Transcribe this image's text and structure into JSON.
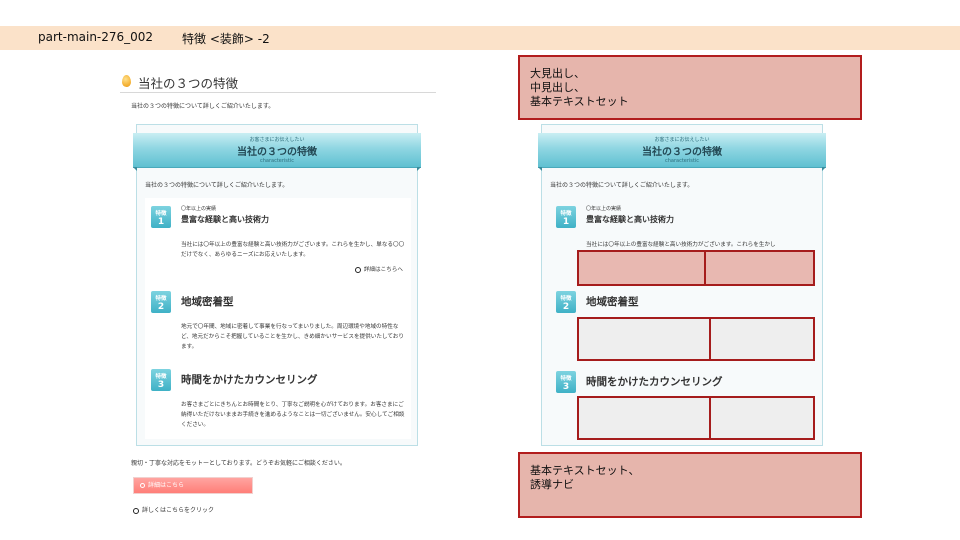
{
  "header": {
    "part_id": "part-main-276_002",
    "title": "特徴 <装飾> -2"
  },
  "section": {
    "heading": "当社の３つの特徴",
    "lead": "当社の３つの特徴について詳しくご紹介いたします。"
  },
  "panel": {
    "ribbon_sub": "お客さまにお伝えしたい",
    "ribbon_title": "当社の３つの特徴",
    "ribbon_en": "characteristic",
    "lead": "当社の３つの特徴について詳しくご紹介いたします。",
    "badge_word": "特徴",
    "features": [
      {
        "num": "1",
        "pre": "〇年以上の実績",
        "title": "豊富な経験と高い技術力",
        "body": "当社には〇年以上の豊富な経験と高い技術力がございます。これらを生かし、単なる〇〇だけでなく、あらゆるニーズにお応えいたします。",
        "link": "詳細はこちらへ"
      },
      {
        "num": "2",
        "title": "地域密着型",
        "body": "地元で〇年間、地域に密着して事業を行なってまいりました。周辺環境や地域の特性など、地元だからこそ把握していることを生かし、きめ細かいサービスを提供いたしております。"
      },
      {
        "num": "3",
        "title": "時間をかけたカウンセリング",
        "body": "お客さまごとにきちんとお時間をとり、丁寧なご説明を心がけております。お客さまにご納得いただけないままお手続きを進めるようなことは一切ございません。安心してご相談ください。"
      }
    ]
  },
  "footer": {
    "text": "親切・丁寧な対応をモットーとしております。どうぞお気軽にご相談ください。",
    "button_label": "詳細はこちら",
    "link_label": "詳しくはこちらをクリック"
  },
  "notes": {
    "top": [
      "大見出し、",
      "中見出し、",
      "基本テキストセット"
    ],
    "bottom": [
      "基本テキストセット、",
      "誘導ナビ"
    ]
  },
  "right_preview": {
    "feature1_body_line": "当社には〇年以上の豊富な経験と高い技術力がございます。これらを生かし"
  },
  "colors": {
    "header_band": "#fbe2c9",
    "ribbon": "#8fd6e2",
    "badge": "#3fb1c6",
    "button": "#ff7e78",
    "note_fill": "#e6b5ac",
    "note_border": "#b21d1d"
  }
}
